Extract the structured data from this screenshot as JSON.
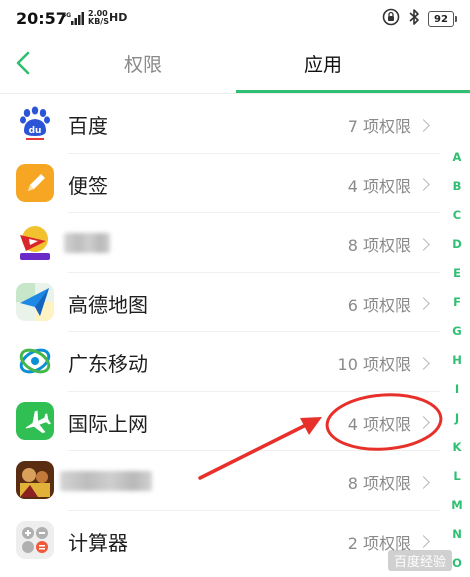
{
  "status_bar": {
    "time": "20:57",
    "network": "4G",
    "speed_value": "2.00",
    "speed_unit": "KB/S",
    "hd": "HD",
    "battery": "92"
  },
  "header": {
    "tabs": [
      {
        "label": "权限",
        "active": false
      },
      {
        "label": "应用",
        "active": true
      }
    ]
  },
  "apps": [
    {
      "name": "百度",
      "permissions": "7 项权限",
      "icon": "baidu-icon"
    },
    {
      "name": "便签",
      "permissions": "4 项权限",
      "icon": "notes-icon"
    },
    {
      "name": "",
      "permissions": "8 项权限",
      "icon": "game-icon",
      "name_blurred": true
    },
    {
      "name": "高德地图",
      "permissions": "6 项权限",
      "icon": "amap-icon"
    },
    {
      "name": "广东移动",
      "permissions": "10 项权限",
      "icon": "china-mobile-icon"
    },
    {
      "name": "国际上网",
      "permissions": "4 项权限",
      "icon": "airplane-icon"
    },
    {
      "name": "",
      "permissions": "8 项权限",
      "icon": "game-2-icon",
      "name_blurred": true
    },
    {
      "name": "计算器",
      "permissions": "2 项权限",
      "icon": "calculator-icon"
    }
  ],
  "alpha_index": [
    "A",
    "B",
    "C",
    "D",
    "E",
    "F",
    "G",
    "H",
    "I",
    "J",
    "K",
    "L",
    "M",
    "N",
    "O"
  ],
  "colors": {
    "accent": "#2fbf72",
    "annotation": "#e8302a"
  },
  "watermark": "百度经验"
}
